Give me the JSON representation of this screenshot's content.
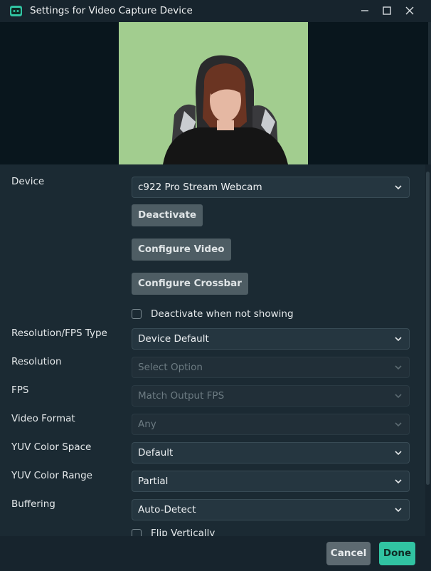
{
  "window": {
    "title": "Settings for Video Capture Device",
    "accent_color": "#31c3a2"
  },
  "preview": {
    "icon": "webcam-video-preview"
  },
  "settings": {
    "device": {
      "label": "Device",
      "value": "c922 Pro Stream Webcam",
      "buttons": [
        "Deactivate",
        "Configure Video",
        "Configure Crossbar"
      ],
      "deactivate_checkbox": {
        "label": "Deactivate when not showing",
        "checked": false
      }
    },
    "rows": [
      {
        "label": "Resolution/FPS Type",
        "value": "Device Default",
        "disabled": false
      },
      {
        "label": "Resolution",
        "value": "Select Option",
        "disabled": true
      },
      {
        "label": "FPS",
        "value": "Match Output FPS",
        "disabled": true
      },
      {
        "label": "Video Format",
        "value": "Any",
        "disabled": true
      },
      {
        "label": "YUV Color Space",
        "value": "Default",
        "disabled": false
      },
      {
        "label": "YUV Color Range",
        "value": "Partial",
        "disabled": false
      },
      {
        "label": "Buffering",
        "value": "Auto-Detect",
        "disabled": false
      }
    ],
    "flip_checkbox": {
      "label": "Flip Vertically",
      "checked": false
    }
  },
  "footer": {
    "cancel_label": "Cancel",
    "done_label": "Done"
  }
}
